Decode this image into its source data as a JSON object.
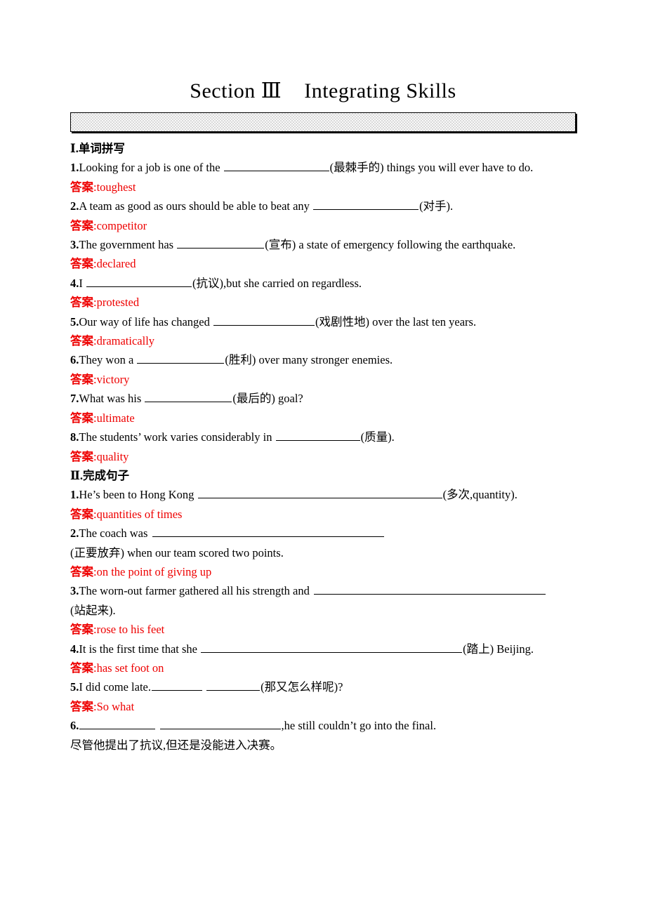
{
  "document": {
    "title": "Section Ⅲ    Integrating Skills",
    "accent_red": "#ee0000",
    "banner_fill": "#d9d9d9"
  },
  "sections": [
    {
      "heading": "Ⅰ.单词拼写",
      "items": [
        {
          "num": "1.",
          "before": "Looking for a job is one of the ",
          "blank_width": 150,
          "after": "(最棘手的) things you will ever have to do.",
          "answer_label": "答案",
          "answer": ":toughest"
        },
        {
          "num": "2.",
          "before": "A team as good as ours should be able to beat any ",
          "blank_width": 150,
          "after": "(对手).",
          "answer_label": "答案",
          "answer": ":competitor"
        },
        {
          "num": "3.",
          "before": "The government has ",
          "blank_width": 124,
          "after": "(宣布) a state of emergency following the earthquake.",
          "answer_label": "答案",
          "answer": ":declared"
        },
        {
          "num": "4.",
          "before": "I ",
          "blank_width": 150,
          "after": "(抗议),but she carried on regardless.",
          "answer_label": "答案",
          "answer": ":protested"
        },
        {
          "num": "5.",
          "before": "Our way of life has changed ",
          "blank_width": 144,
          "after": "(戏剧性地) over the last ten years.",
          "answer_label": "答案",
          "answer": ":dramatically"
        },
        {
          "num": "6.",
          "before": "They won a ",
          "blank_width": 124,
          "after": "(胜利) over many stronger enemies.",
          "answer_label": "答案",
          "answer": ":victory"
        },
        {
          "num": "7.",
          "before": "What was his ",
          "blank_width": 124,
          "after": "(最后的) goal?",
          "answer_label": "答案",
          "answer": ":ultimate"
        },
        {
          "num": "8.",
          "before": "The students’ work varies considerably in ",
          "blank_width": 120,
          "after": "(质量).",
          "answer_label": "答案",
          "answer": ":quality"
        }
      ]
    },
    {
      "heading": "Ⅱ.完成句子",
      "items": [
        {
          "num": "1.",
          "before": "He’s been to Hong Kong ",
          "blank_width": 348,
          "after": "(多次,quantity).",
          "answer_label": "答案",
          "answer": ":quantities of times"
        },
        {
          "num": "2.",
          "before": "The coach was ",
          "blank_width": 0,
          "blank_fill": true,
          "after": "(正要放弃) when our team scored two points.",
          "answer_label": "答案",
          "answer": ":on the point of giving up"
        },
        {
          "num": "3.",
          "before": "The worn-out farmer gathered all his strength and ",
          "blank_width": 0,
          "blank_fill": true,
          "after": "(站起来).",
          "answer_label": "答案",
          "answer": ":rose to his feet"
        },
        {
          "num": "4.",
          "before": "It is the first time that she ",
          "blank_width": 372,
          "after": "(踏上) Beijing.",
          "answer_label": "答案",
          "answer": ":has set foot on"
        },
        {
          "num": "5.",
          "before": "I did come late.",
          "blank_width": 72,
          "blank2_width": 76,
          "after": "(那又怎么样呢)?",
          "answer_label": "答案",
          "answer": ":So what"
        },
        {
          "num": "6.",
          "before": "",
          "blank_width": 108,
          "blank2_width": 172,
          "after": ",he still couldn’t go into the final.",
          "note": "尽管他提出了抗议,但还是没能进入决赛。"
        }
      ]
    }
  ]
}
